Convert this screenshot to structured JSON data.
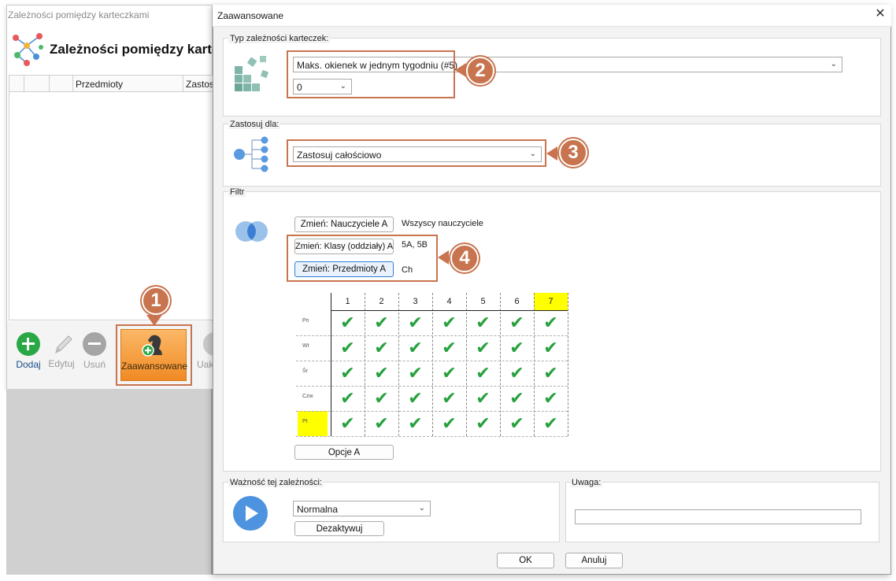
{
  "background_window": {
    "title": "Zależności pomiędzy karteczkami",
    "heading": "Zależności pomiędzy karte",
    "columns": [
      "Przedmioty",
      "Zastos"
    ],
    "toolbar": [
      {
        "label": "Dodaj",
        "icon": "plus-circle-icon",
        "color": "#2aa845"
      },
      {
        "label": "Edytuj",
        "icon": "pencil-icon",
        "color": "#9a9a9a"
      },
      {
        "label": "Usuń",
        "icon": "minus-circle-icon",
        "color": "#9a9a9a"
      },
      {
        "label": "Zaawansowane",
        "icon": "chess-knight-add-icon",
        "color": "#f08a24"
      },
      {
        "label": "Uak",
        "icon": "circle-icon",
        "color": "#9a9a9a"
      }
    ]
  },
  "dialog": {
    "title": "Zaawansowane",
    "close_glyph": "✕",
    "section_type": {
      "label": "Typ zależności karteczek:",
      "type_value": "Maks. okienek w jednym tygodniu (#5)",
      "count_value": "0"
    },
    "section_apply": {
      "label": "Zastosuj dla:",
      "value": "Zastosuj całościowo"
    },
    "section_filter": {
      "label": "Filtr",
      "buttons": [
        {
          "label": "Zmień: Nauczyciele A",
          "value": "Wszyscy nauczyciele"
        },
        {
          "label": "Zmień: Klasy (oddziały) A",
          "value": "5A, 5B"
        },
        {
          "label": "Zmień: Przedmioty A",
          "value": "Ch"
        }
      ],
      "periods": [
        "1",
        "2",
        "3",
        "4",
        "5",
        "6",
        "7"
      ],
      "days": [
        "Pn",
        "Wt",
        "Śr",
        "Czw",
        "Pt"
      ],
      "highlight_color": "#ffff00",
      "check_glyph": "✔",
      "check_color": "#27a13d",
      "options_button": "Opcje A"
    },
    "section_importance": {
      "label": "Ważność tej zależności:",
      "value": "Normalna",
      "deactivate_button": "Dezaktywuj"
    },
    "section_note": {
      "label": "Uwaga:",
      "value": ""
    },
    "ok_button": "OK",
    "cancel_button": "Anuluj"
  },
  "callouts": [
    "1",
    "2",
    "3",
    "4"
  ],
  "accent_color": "#c8744e"
}
